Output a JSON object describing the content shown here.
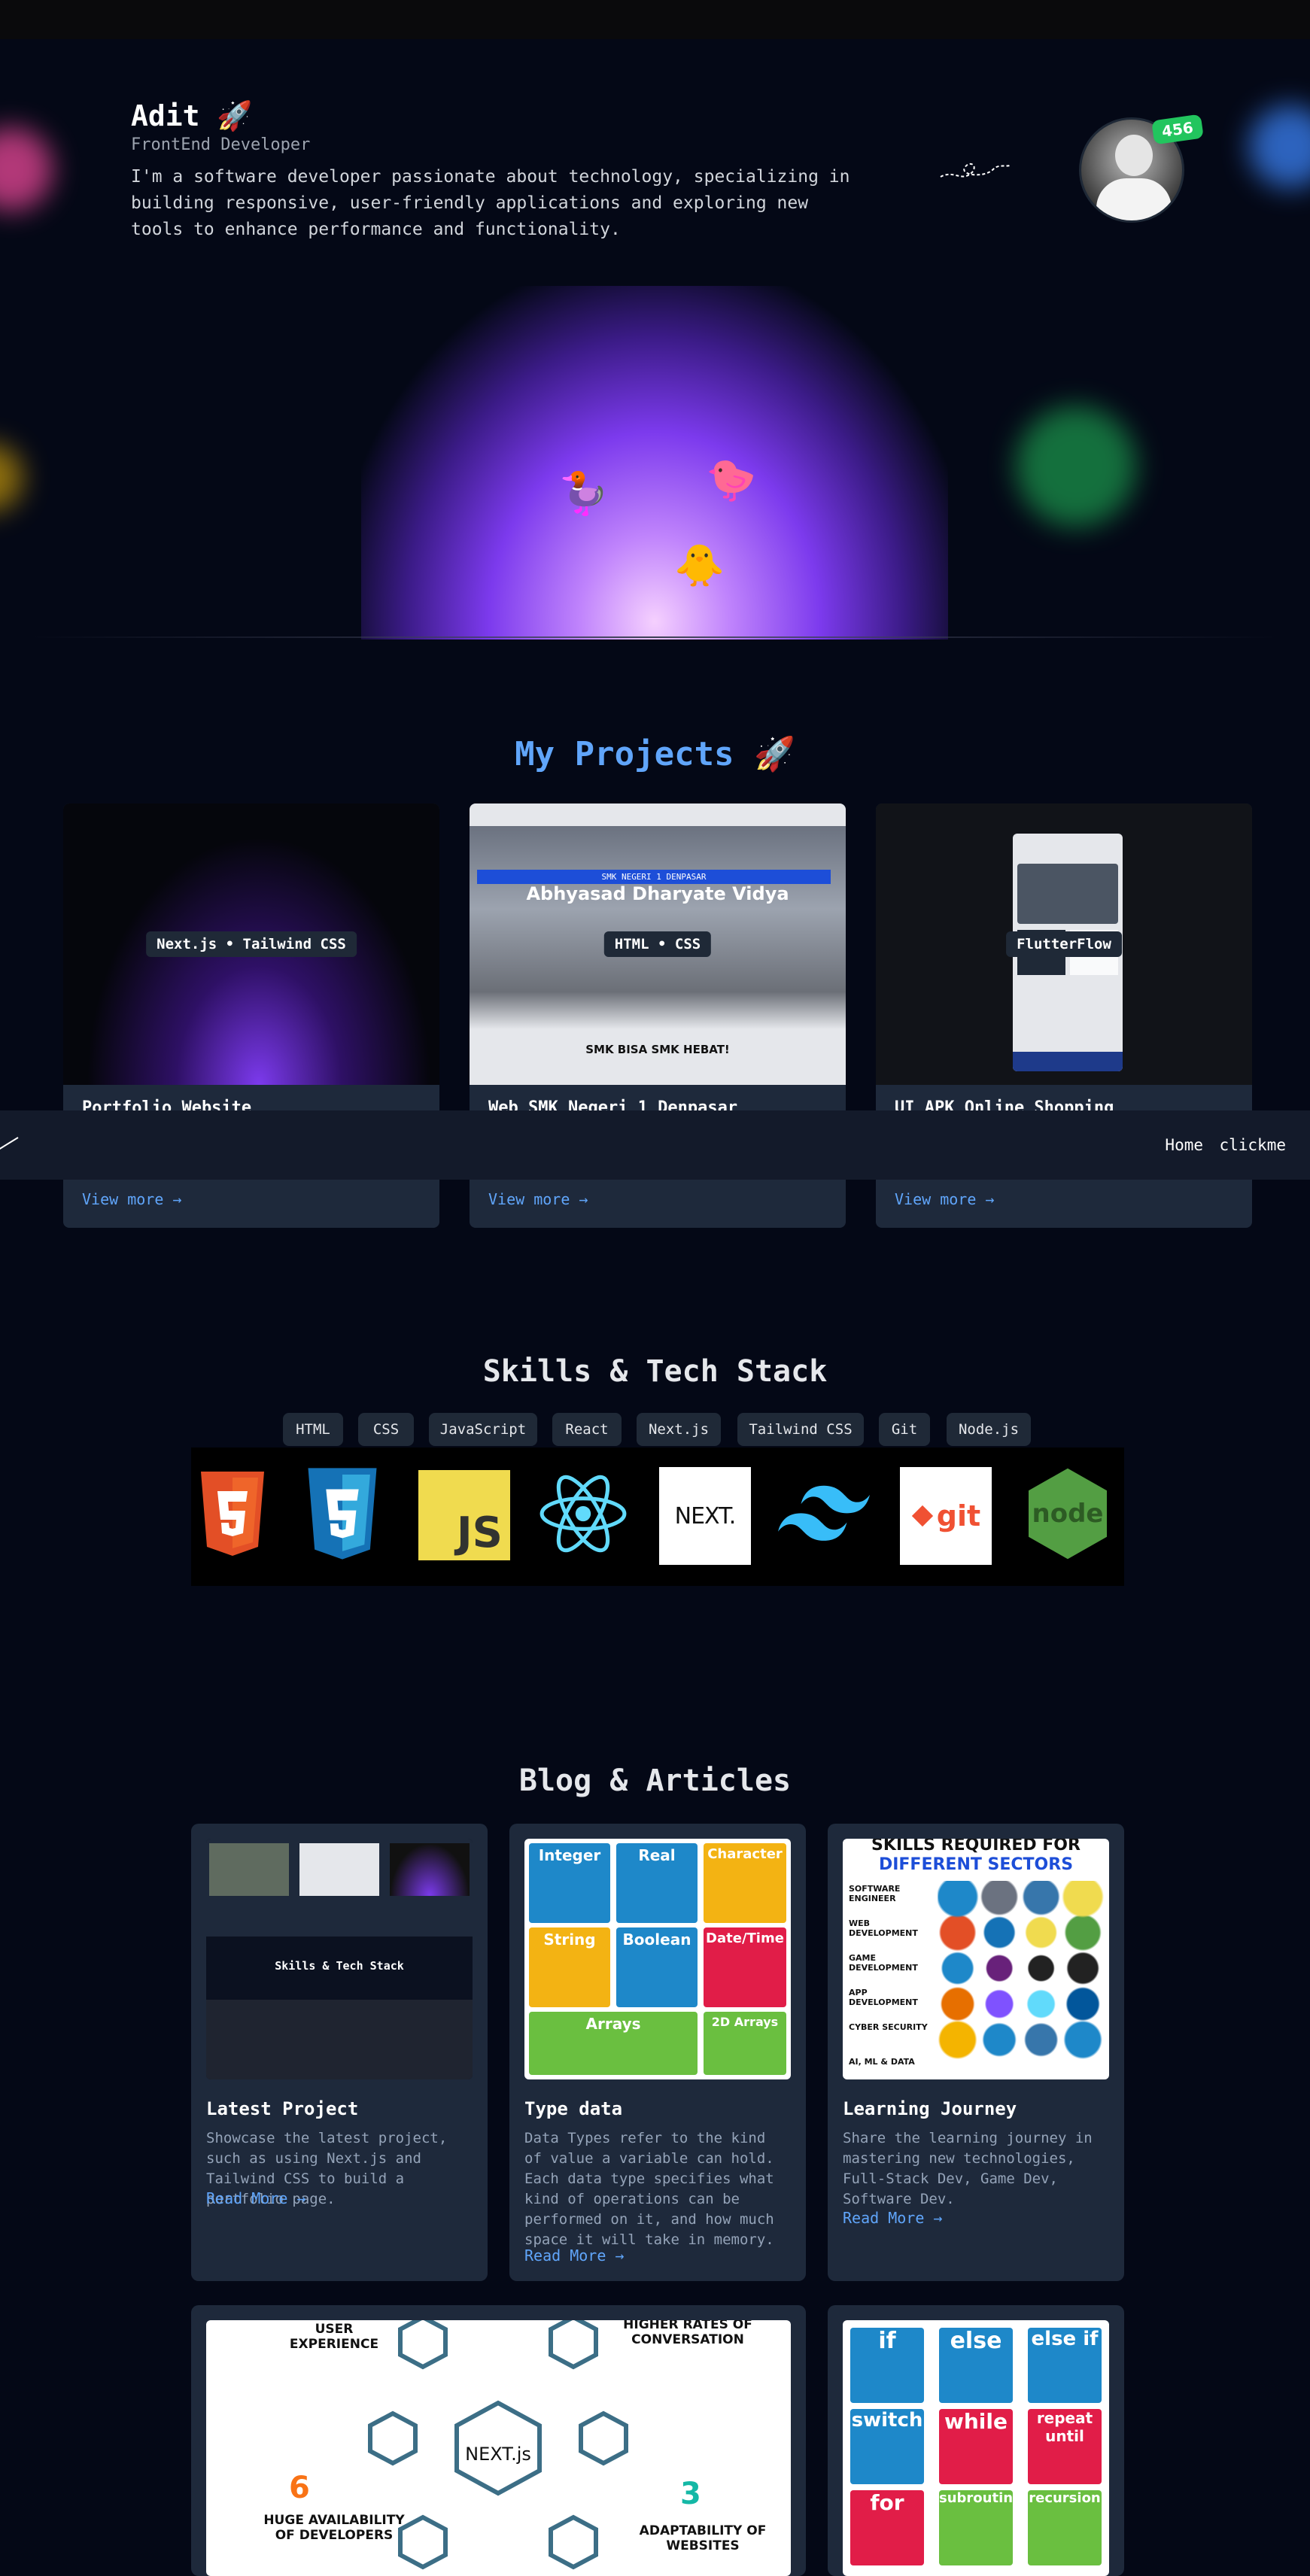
{
  "hero": {
    "name": "Adit 🚀",
    "role": "FrontEnd Developer",
    "bio": "I'm a software developer passionate about technology, specializing in building responsive, user-friendly applications and exploring new tools to enhance performance and functionality.",
    "badge": "456"
  },
  "projects": {
    "title": "My Projects 🚀",
    "cards": [
      {
        "tag": "Next.js • Tailwind CSS",
        "title": "Portfolio Website",
        "link": "View more →"
      },
      {
        "tag": "HTML • CSS",
        "title": "Web SMK Negeri 1 Denpasar",
        "link": "View more →",
        "thumb_header": "SMK NEGERI 1 DENPASAR",
        "thumb_title": "Abhyasad Dharyate Vidya",
        "thumb_footer": "SMK BISA SMK HEBAT!"
      },
      {
        "tag": "FlutterFlow",
        "title": "UI APK Online Shopping",
        "link": "View more →"
      }
    ]
  },
  "navbar": {
    "home": "Home",
    "clickme": "clickme"
  },
  "skills": {
    "title": "Skills & Tech Stack",
    "items": [
      "HTML",
      "CSS",
      "JavaScript",
      "React",
      "Next.js",
      "Tailwind CSS",
      "Git",
      "Node.js"
    ],
    "logos": {
      "js": "JS",
      "next": "NEXT.",
      "git": "git",
      "node": "node"
    }
  },
  "blog": {
    "title": "Blog & Articles",
    "cards": [
      {
        "title": "Latest Project",
        "desc": "Showcase the latest project, such as using Next.js and Tailwind CSS to build a portfolio page.",
        "link": "Read More →",
        "thumb_title": "Skills & Tech Stack"
      },
      {
        "title": "Type data",
        "desc": "Data Types refer to the kind of value a variable can hold. Each data type specifies what kind of operations can be performed on it, and how much space it will take in memory.",
        "link": "Read More →",
        "cells": [
          "Integer",
          "Real",
          "Character",
          "String",
          "Boolean",
          "Date/Time",
          "Arrays",
          "2D Arrays"
        ]
      },
      {
        "title": "Learning Journey",
        "desc": "Share the learning journey in mastering new technologies, Full-Stack Dev, Game Dev, Software Dev.",
        "link": "Read More →",
        "thumb_head1": "SKILLS REQUIRED FOR",
        "thumb_head2": "DIFFERENT SECTORS",
        "rows": [
          "SOFTWARE ENGINEER",
          "WEB DEVELOPMENT",
          "GAME DEVELOPMENT",
          "APP DEVELOPMENT",
          "CYBER SECURITY",
          "AI, ML & DATA"
        ]
      }
    ],
    "nextjs_card": {
      "tl": "USER EXPERIENCE",
      "tr": "HIGHER RATES OF CONVERSATION",
      "bl_num": "6",
      "bl": "HUGE AVAILABILITY OF DEVELOPERS",
      "br_num": "3",
      "br": "ADAPTABILITY OF WEBSITES",
      "center": "NEXT.js"
    },
    "cond_card": {
      "cells": [
        "if",
        "else",
        "else if",
        "switch",
        "while",
        "repeat until",
        "for",
        "subroutine",
        "recursion"
      ]
    }
  },
  "colors": {
    "background": "#040816",
    "accent": "#60a5fa",
    "card": "#1e293b",
    "badge": "#22c55e"
  }
}
